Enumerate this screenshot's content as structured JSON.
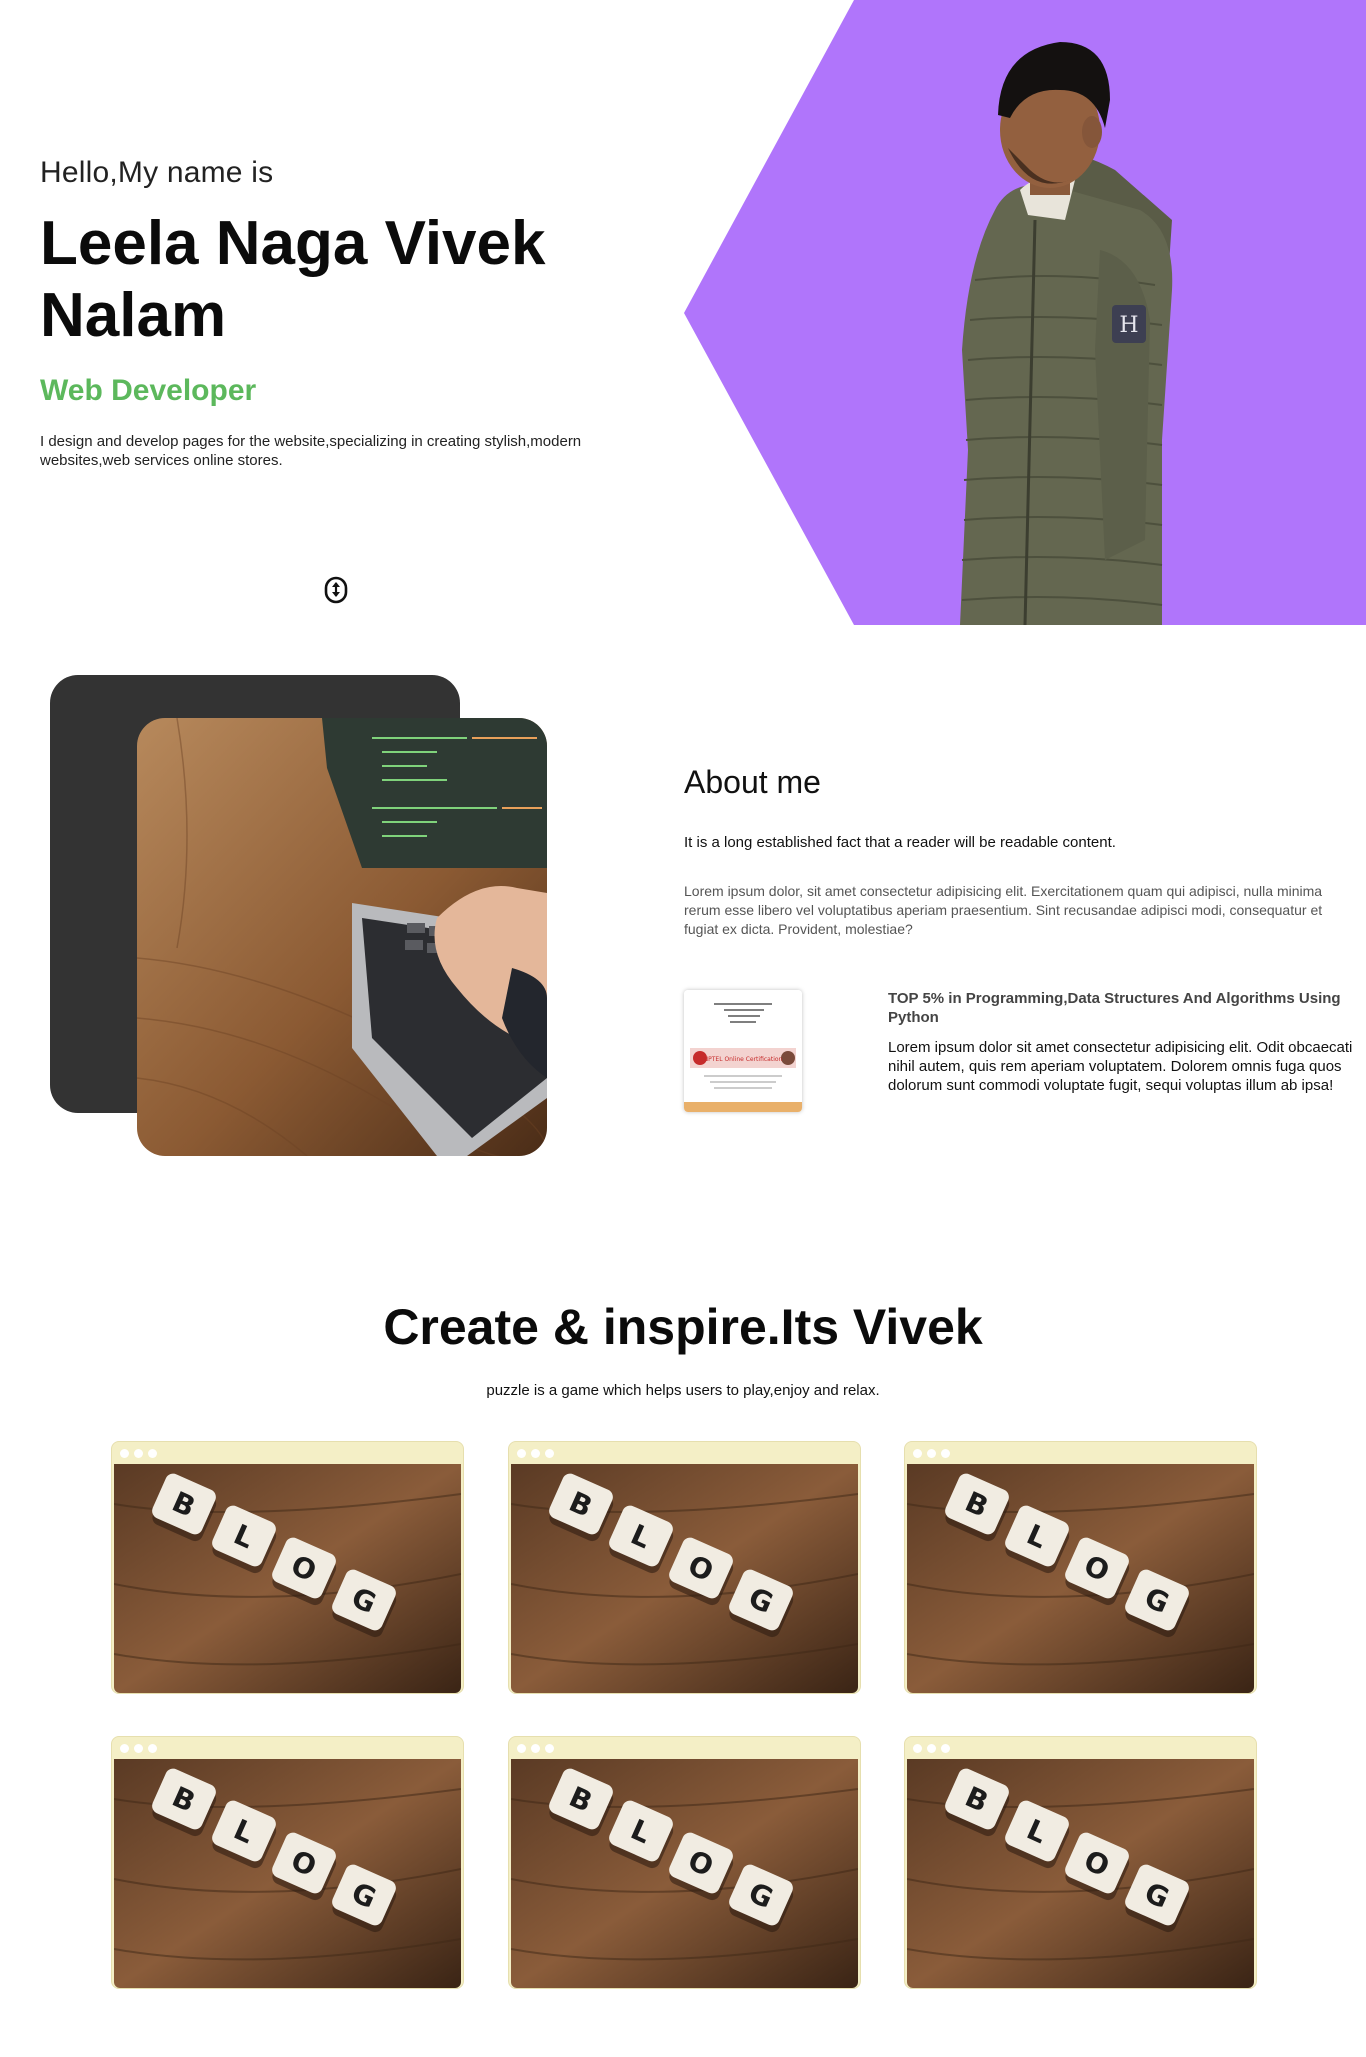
{
  "hero": {
    "greeting": "Hello,My name is",
    "name": "Leela Naga Vivek Nalam",
    "role": "Web Developer",
    "intro": "I design and develop pages for the website,specializing in creating stylish,modern websites,web services online stores.",
    "scroll_icon": "mouse-scroll-icon",
    "accent_color": "#b075fb"
  },
  "about": {
    "title": "About me",
    "lead": "It is a long established fact that a reader will be readable content.",
    "body": "Lorem ipsum dolor, sit amet consectetur adipisicing elit. Exercitationem quam qui adipisci, nulla minima rerum esse libero vel voluptatibus aperiam praesentium. Sint recusandae adipisci modi, consequatur et fugiat ex dicta. Provident, molestiae?",
    "certificate": {
      "title": "TOP 5% in Programming,Data Structures And Algorithms Using Python",
      "body": "Lorem ipsum dolor sit amet consectetur adipisicing elit. Odit obcaecati nihil autem, quis rem aperiam voluptatem. Dolorem omnis fuga quos dolorum sunt commodi voluptate fugit, sequi voluptas illum ab ipsa!",
      "thumb_heading": "NPTEL Online Certification"
    }
  },
  "projects": {
    "title": "Create & inspire.Its Vivek",
    "subtitle": "puzzle is a game which helps users to play,enjoy and relax.",
    "card_color": "#f4efc6",
    "cards": [
      {
        "tiles": [
          "B",
          "L",
          "O",
          "G"
        ]
      },
      {
        "tiles": [
          "B",
          "L",
          "O",
          "G"
        ]
      },
      {
        "tiles": [
          "B",
          "L",
          "O",
          "G"
        ]
      },
      {
        "tiles": [
          "B",
          "L",
          "O",
          "G"
        ]
      },
      {
        "tiles": [
          "B",
          "L",
          "O",
          "G"
        ]
      },
      {
        "tiles": [
          "B",
          "L",
          "O",
          "G"
        ]
      }
    ]
  }
}
